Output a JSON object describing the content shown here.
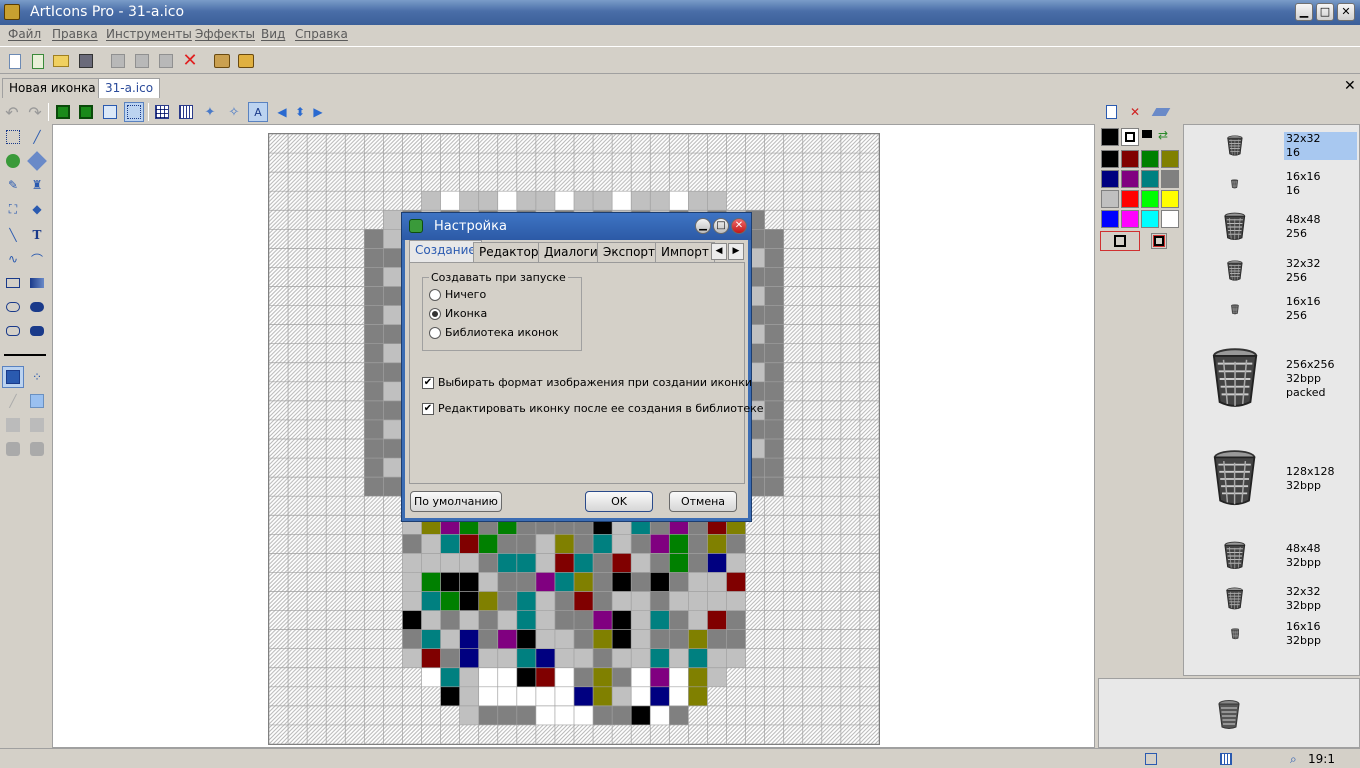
{
  "window": {
    "title": "ArtIcons Pro - 31-a.ico"
  },
  "menu": [
    "Файл",
    "Правка",
    "Инструменты",
    "Эффекты",
    "Вид",
    "Справка"
  ],
  "tabs": [
    {
      "label": "Новая иконка 1",
      "active": false
    },
    {
      "label": "31-a.ico",
      "active": true
    }
  ],
  "formats": [
    {
      "size": "32x32",
      "depth": "16",
      "selected": true
    },
    {
      "size": "16x16",
      "depth": "16"
    },
    {
      "size": "48x48",
      "depth": "256"
    },
    {
      "size": "32x32",
      "depth": "256"
    },
    {
      "size": "16x16",
      "depth": "256"
    },
    {
      "size": "256x256",
      "depth": "32bpp",
      "extra": "packed"
    },
    {
      "size": "128x128",
      "depth": "32bpp"
    },
    {
      "size": "48x48",
      "depth": "32bpp"
    },
    {
      "size": "32x32",
      "depth": "32bpp"
    },
    {
      "size": "16x16",
      "depth": "32bpp"
    }
  ],
  "status": {
    "zoom": "19:1"
  },
  "palette": [
    "#000000",
    "#800000",
    "#008000",
    "#808000",
    "#000080",
    "#800080",
    "#008080",
    "#808080",
    "#c0c0c0",
    "#ff0000",
    "#00ff00",
    "#ffff00",
    "#0000ff",
    "#ff00ff",
    "#00ffff",
    "#ffffff"
  ],
  "dialog": {
    "title": "Настройка",
    "tabs": [
      "Создание",
      "Редактор",
      "Диалоги",
      "Экспорт",
      "Импорт"
    ],
    "active_tab": "Создание",
    "group_title": "Создавать при запуске",
    "radios": [
      {
        "label": "Ничего",
        "checked": false
      },
      {
        "label": "Иконка",
        "checked": true
      },
      {
        "label": "Библиотека иконок",
        "checked": false
      }
    ],
    "checkboxes": [
      {
        "label": "Выбирать формат изображения при создании иконки",
        "checked": true
      },
      {
        "label": "Редактировать иконку после ее создания в библиотеке",
        "checked": true
      }
    ],
    "buttons": {
      "default": "По умолчанию",
      "ok": "OK",
      "cancel": "Отмена"
    }
  }
}
